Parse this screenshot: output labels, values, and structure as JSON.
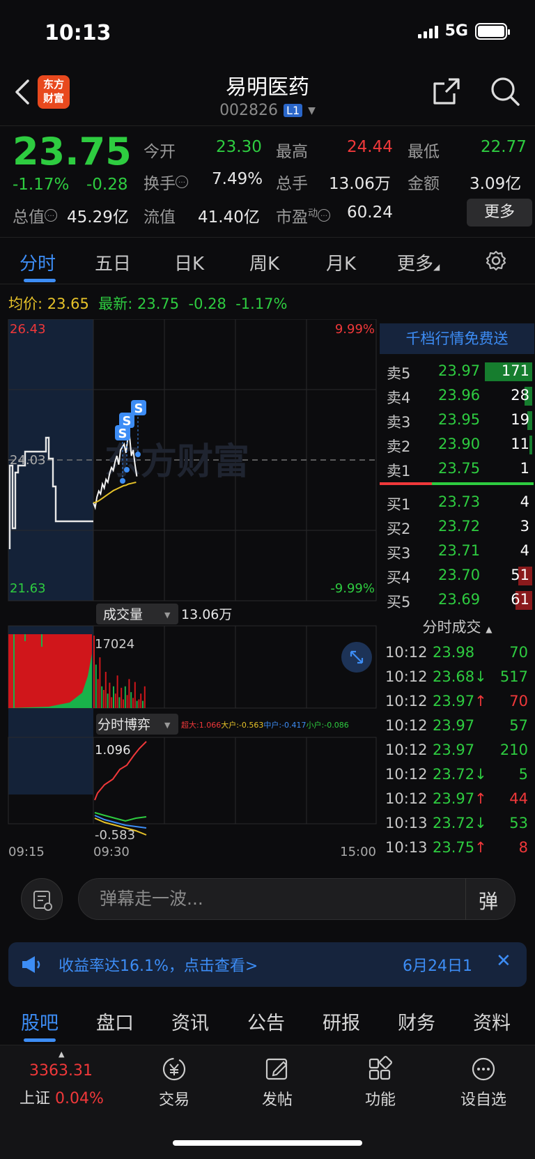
{
  "status_bar": {
    "time": "10:13",
    "network": "5G"
  },
  "header": {
    "logo_line1": "东方",
    "logo_line2": "财富",
    "stock_name": "易明医药",
    "stock_code": "002826",
    "level_badge": "L1"
  },
  "quote": {
    "price": "23.75",
    "change_pct": "-1.17%",
    "change": "-0.28",
    "open_label": "今开",
    "open": "23.30",
    "high_label": "最高",
    "high": "24.44",
    "low_label": "最低",
    "low": "22.77",
    "turnover_label": "换手",
    "turnover": "7.49%",
    "volume_label": "总手",
    "volume": "13.06万",
    "amount_label": "金额",
    "amount": "3.09亿",
    "mktcap_label": "总值",
    "mktcap": "45.29亿",
    "float_label": "流值",
    "float_cap": "41.40亿",
    "pe_label": "市盈",
    "pe_sup": "动",
    "pe": "60.24",
    "more": "更多"
  },
  "tabs": [
    "分时",
    "五日",
    "日K",
    "周K",
    "月K",
    "更多"
  ],
  "avg_line": {
    "avg_label": "均价:",
    "avg": "23.65",
    "latest_label": "最新:",
    "latest": "23.75",
    "chg": "-0.28",
    "chg_pct": "-1.17%"
  },
  "chart": {
    "max_price": "26.43",
    "max_pct": "9.99%",
    "mid_price": "24.03",
    "min_price": "21.63",
    "min_pct": "-9.99%",
    "watermark": "东方财富",
    "volume_selector": "成交量",
    "volume_total": "13.06万",
    "volume_max": "17024",
    "game_selector": "分时博弈",
    "game_legend": [
      {
        "label": "超大:1.066",
        "color": "#f0383a"
      },
      {
        "label": "大户:-0.563",
        "color": "#e6c229"
      },
      {
        "label": "中户:-0.417",
        "color": "#3d8df5"
      },
      {
        "label": "小户:-0.086",
        "color": "#2ecc40"
      }
    ],
    "game_top": "1.096",
    "game_bottom": "-0.583",
    "time_start": "09:15",
    "time_open": "09:30",
    "time_end": "15:00",
    "marker": "S",
    "intraday_prices": [
      23.3,
      23.22,
      23.4,
      23.5,
      23.45,
      23.62,
      23.55,
      23.7,
      23.65,
      23.8,
      23.9,
      23.85,
      24.0,
      24.1,
      23.95,
      24.2,
      24.25,
      24.3,
      24.15,
      24.4,
      24.44,
      24.1,
      24.2,
      23.95,
      23.75
    ],
    "avg_prices": [
      23.3,
      23.31,
      23.33,
      23.36,
      23.39,
      23.42,
      23.45,
      23.48,
      23.51,
      23.53,
      23.55,
      23.57,
      23.59,
      23.6,
      23.62,
      23.63,
      23.64,
      23.65
    ]
  },
  "order_book": {
    "header": "千档行情免费送",
    "asks": [
      {
        "label": "卖5",
        "price": "23.97",
        "vol": "171",
        "bar": 1.0
      },
      {
        "label": "卖4",
        "price": "23.96",
        "vol": "28",
        "bar": 0.16
      },
      {
        "label": "卖3",
        "price": "23.95",
        "vol": "19",
        "bar": 0.11
      },
      {
        "label": "卖2",
        "price": "23.90",
        "vol": "11",
        "bar": 0.06
      },
      {
        "label": "卖1",
        "price": "23.75",
        "vol": "1",
        "bar": 0.01
      }
    ],
    "bids": [
      {
        "label": "买1",
        "price": "23.73",
        "vol": "4",
        "bar": 0.02
      },
      {
        "label": "买2",
        "price": "23.72",
        "vol": "3",
        "bar": 0.02
      },
      {
        "label": "买3",
        "price": "23.71",
        "vol": "4",
        "bar": 0.02
      },
      {
        "label": "买4",
        "price": "23.70",
        "vol": "51",
        "bar": 0.3
      },
      {
        "label": "买5",
        "price": "23.69",
        "vol": "61",
        "bar": 0.36
      }
    ],
    "ticks_header": "分时成交",
    "ticks": [
      {
        "time": "10:12",
        "price": "23.98",
        "dir": "",
        "vol": "70",
        "pc": "green",
        "vc": "green"
      },
      {
        "time": "10:12",
        "price": "23.68",
        "dir": "↓",
        "vol": "517",
        "pc": "green",
        "vc": "green"
      },
      {
        "time": "10:12",
        "price": "23.97",
        "dir": "↑",
        "vol": "70",
        "pc": "green",
        "vc": "red"
      },
      {
        "time": "10:12",
        "price": "23.97",
        "dir": "",
        "vol": "57",
        "pc": "green",
        "vc": "green"
      },
      {
        "time": "10:12",
        "price": "23.97",
        "dir": "",
        "vol": "210",
        "pc": "green",
        "vc": "green"
      },
      {
        "time": "10:12",
        "price": "23.72",
        "dir": "↓",
        "vol": "5",
        "pc": "green",
        "vc": "green"
      },
      {
        "time": "10:12",
        "price": "23.97",
        "dir": "↑",
        "vol": "44",
        "pc": "green",
        "vc": "red"
      },
      {
        "time": "10:13",
        "price": "23.72",
        "dir": "↓",
        "vol": "53",
        "pc": "green",
        "vc": "green"
      },
      {
        "time": "10:13",
        "price": "23.75",
        "dir": "↑",
        "vol": "8",
        "pc": "green",
        "vc": "red"
      }
    ]
  },
  "danmaku": {
    "placeholder": "弹幕走一波...",
    "send_glyph": "弹"
  },
  "notice": {
    "text": "收益率达16.1%，点击查看>",
    "date": "6月24日1",
    "close": "✕"
  },
  "subtabs": [
    "股吧",
    "盘口",
    "资讯",
    "公告",
    "研报",
    "财务",
    "资料"
  ],
  "bottom_nav": {
    "index_value": "3363.31",
    "index_name": "上证",
    "index_pct": "0.04%",
    "items": [
      "交易",
      "发帖",
      "功能",
      "设自选"
    ]
  }
}
